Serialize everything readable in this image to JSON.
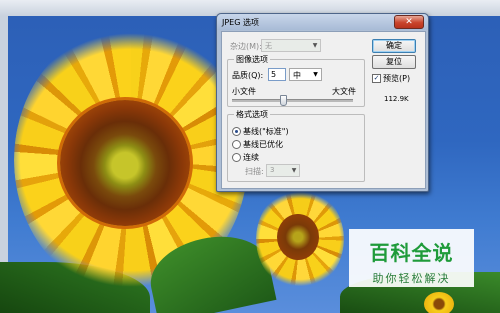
{
  "dialog": {
    "title": "JPEG 选项",
    "close_glyph": "✕",
    "matte": {
      "label": "杂边(M):",
      "value": "无"
    },
    "image_options": {
      "group_title": "图像选项",
      "quality_label": "品质(Q):",
      "quality_value": "5",
      "quality_level": "中",
      "small_file_label": "小文件",
      "large_file_label": "大文件",
      "slider_fraction": 0.42
    },
    "format_options": {
      "group_title": "格式选项",
      "baseline_standard": "基线(\"标准\")",
      "baseline_optimized": "基线已优化",
      "progressive": "连续",
      "scans_label": "扫描:",
      "scans_value": "3",
      "selected": "baseline_standard"
    },
    "buttons": {
      "ok": "确定",
      "reset": "复位"
    },
    "preview": {
      "label": "预览(P)",
      "checked": true,
      "check_glyph": "✓",
      "file_size": "112.9K"
    },
    "dropdown_arrow": "▼"
  },
  "watermark": {
    "main": "百科全说",
    "sub": "助你轻松解决"
  }
}
